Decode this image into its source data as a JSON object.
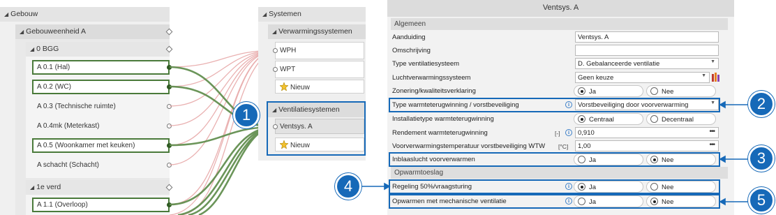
{
  "left_tree": {
    "building_header": "Gebouw",
    "unit_header": "Gebouweenheid A",
    "floor0_header": "0 BGG",
    "floor0_rooms": [
      {
        "label": "A 0.1 (Hal)",
        "linked": true
      },
      {
        "label": "A 0.2 (WC)",
        "linked": true
      },
      {
        "label": "A 0.3 (Technische ruimte)",
        "linked": false
      },
      {
        "label": "A 0.4mk (Meterkast)",
        "linked": false
      },
      {
        "label": "A 0.5 (Woonkamer met keuken)",
        "linked": true
      },
      {
        "label": "A schacht (Schacht)",
        "linked": false
      }
    ],
    "floor1_header": "1e verd",
    "floor1_rooms": [
      {
        "label": "A 1.1 (Overloop)",
        "linked": true
      }
    ]
  },
  "systems": {
    "header": "Systemen",
    "heating_header": "Verwarmingssystemen",
    "heating_items": [
      "WPH",
      "WPT"
    ],
    "heating_new": "Nieuw",
    "ventilation_header": "Ventilatiesystemen",
    "ventilation_items": [
      "Ventsys. A"
    ],
    "ventilation_new": "Nieuw"
  },
  "callouts": [
    "1",
    "2",
    "3",
    "4",
    "5"
  ],
  "properties": {
    "title": "Ventsys. A",
    "section_general": "Algemeen",
    "aanduiding_label": "Aanduiding",
    "aanduiding_value": "Ventsys. A",
    "omschrijving_label": "Omschrijving",
    "omschrijving_value": "",
    "type_vent_label": "Type ventilatiesysteem",
    "type_vent_value": "D. Gebalanceerde ventilatie",
    "luchtverw_label": "Luchtverwarmingssysteem",
    "luchtverw_value": "Geen keuze",
    "zonering_label": "Zonering/kwaliteitsverklaring",
    "zonering_opt1": "Ja",
    "zonering_opt2": "Nee",
    "zonering_selected": "Ja",
    "wtw_label": "Type warmteterugwinning / vorstbeveiliging",
    "wtw_value": "Vorstbeveiliging door voorverwarming",
    "installatie_label": "Installatietype warmteterugwinning",
    "installatie_opt1": "Centraal",
    "installatie_opt2": "Decentraal",
    "installatie_selected": "Centraal",
    "rendement_label": "Rendement warmteterugwinning",
    "rendement_unit": "[-]",
    "rendement_value": "0,910",
    "voorverw_label": "Voorverwarmingstemperatuur vorstbeveiliging WTW",
    "voorverw_unit": "[°C]",
    "voorverw_value": "1,00",
    "inblaas_label": "Inblaaslucht voorverwarmen",
    "inblaas_opt1": "Ja",
    "inblaas_opt2": "Nee",
    "inblaas_selected": "Nee",
    "section_opwarm": "Opwarmtoeslag",
    "regeling_label": "Regeling 50%/vraagsturing",
    "regeling_opt1": "Ja",
    "regeling_opt2": "Nee",
    "regeling_selected": "Ja",
    "mech_label": "Opwarmen met mechanische ventilatie",
    "mech_opt1": "Ja",
    "mech_opt2": "Nee",
    "mech_selected": "Nee"
  },
  "colors": {
    "callout_blue": "#1669b8",
    "link_green": "#4a7a3a",
    "link_red": "#e0a0a0"
  }
}
